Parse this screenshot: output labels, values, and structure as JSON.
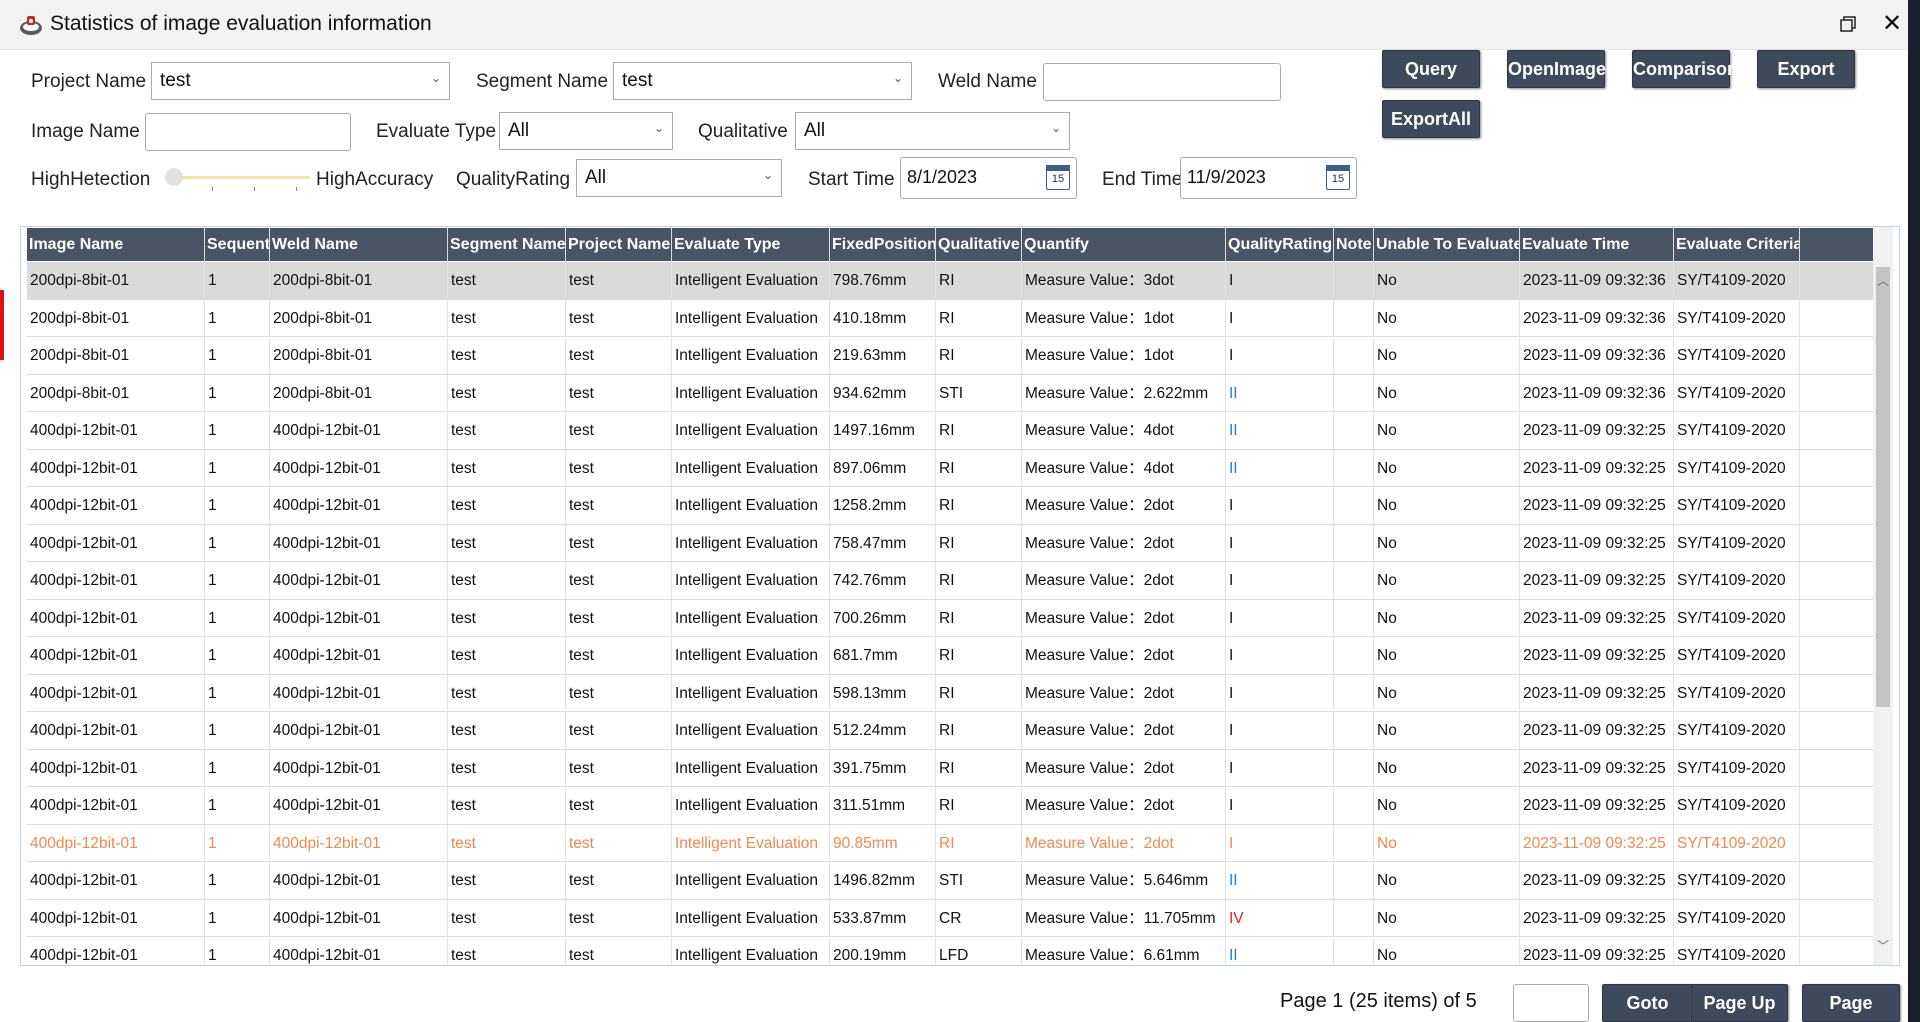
{
  "window": {
    "title": "Statistics of image evaluation information"
  },
  "filters": {
    "project_name_label": "Project Name",
    "project_name_value": "test",
    "segment_name_label": "Segment Name",
    "segment_name_value": "test",
    "weld_name_label": "Weld Name",
    "weld_name_value": "",
    "image_name_label": "Image Name",
    "image_name_value": "",
    "evaluate_type_label": "Evaluate Type",
    "evaluate_type_value": "All",
    "qualitative_label": "Qualitative",
    "qualitative_value": "All",
    "high_detection_label": "HighHetection",
    "high_accuracy_label": "HighAccuracy",
    "quality_rating_label": "QualityRating",
    "quality_rating_value": "All",
    "start_time_label": "Start Time",
    "start_time_value": "8/1/2023",
    "end_time_label": "End Time",
    "end_time_value": "11/9/2023",
    "calendar_day": "15"
  },
  "buttons": {
    "query": "Query",
    "open_image": "OpenImage",
    "comparison": "Comparison",
    "export": "Export",
    "export_all": "ExportAll"
  },
  "grid": {
    "columns": [
      "Image Name",
      "Sequent",
      "Weld Name",
      "Segment Name",
      "Project Name",
      "Evaluate Type",
      "FixedPosition",
      "Qualitative",
      "Quantify",
      "QualityRating",
      "Note",
      "Unable To Evaluate",
      "Evaluate Time",
      "Evaluate Criteria"
    ],
    "rows": [
      [
        "200dpi-8bit-01",
        "1",
        "200dpi-8bit-01",
        "test",
        "test",
        "Intelligent Evaluation",
        "798.76mm",
        "RI",
        "Measure Value：3dot",
        "I",
        "",
        "No",
        "2023-11-09 09:32:36",
        "SY/T4109-2020"
      ],
      [
        "200dpi-8bit-01",
        "1",
        "200dpi-8bit-01",
        "test",
        "test",
        "Intelligent Evaluation",
        "410.18mm",
        "RI",
        "Measure Value：1dot",
        "I",
        "",
        "No",
        "2023-11-09 09:32:36",
        "SY/T4109-2020"
      ],
      [
        "200dpi-8bit-01",
        "1",
        "200dpi-8bit-01",
        "test",
        "test",
        "Intelligent Evaluation",
        "219.63mm",
        "RI",
        "Measure Value：1dot",
        "I",
        "",
        "No",
        "2023-11-09 09:32:36",
        "SY/T4109-2020"
      ],
      [
        "200dpi-8bit-01",
        "1",
        "200dpi-8bit-01",
        "test",
        "test",
        "Intelligent Evaluation",
        "934.62mm",
        "STI",
        "Measure Value：2.622mm",
        "II",
        "",
        "No",
        "2023-11-09 09:32:36",
        "SY/T4109-2020"
      ],
      [
        "400dpi-12bit-01",
        "1",
        "400dpi-12bit-01",
        "test",
        "test",
        "Intelligent Evaluation",
        "1497.16mm",
        "RI",
        "Measure Value：4dot",
        "II",
        "",
        "No",
        "2023-11-09 09:32:25",
        "SY/T4109-2020"
      ],
      [
        "400dpi-12bit-01",
        "1",
        "400dpi-12bit-01",
        "test",
        "test",
        "Intelligent Evaluation",
        "897.06mm",
        "RI",
        "Measure Value：4dot",
        "II",
        "",
        "No",
        "2023-11-09 09:32:25",
        "SY/T4109-2020"
      ],
      [
        "400dpi-12bit-01",
        "1",
        "400dpi-12bit-01",
        "test",
        "test",
        "Intelligent Evaluation",
        "1258.2mm",
        "RI",
        "Measure Value：2dot",
        "I",
        "",
        "No",
        "2023-11-09 09:32:25",
        "SY/T4109-2020"
      ],
      [
        "400dpi-12bit-01",
        "1",
        "400dpi-12bit-01",
        "test",
        "test",
        "Intelligent Evaluation",
        "758.47mm",
        "RI",
        "Measure Value：2dot",
        "I",
        "",
        "No",
        "2023-11-09 09:32:25",
        "SY/T4109-2020"
      ],
      [
        "400dpi-12bit-01",
        "1",
        "400dpi-12bit-01",
        "test",
        "test",
        "Intelligent Evaluation",
        "742.76mm",
        "RI",
        "Measure Value：2dot",
        "I",
        "",
        "No",
        "2023-11-09 09:32:25",
        "SY/T4109-2020"
      ],
      [
        "400dpi-12bit-01",
        "1",
        "400dpi-12bit-01",
        "test",
        "test",
        "Intelligent Evaluation",
        "700.26mm",
        "RI",
        "Measure Value：2dot",
        "I",
        "",
        "No",
        "2023-11-09 09:32:25",
        "SY/T4109-2020"
      ],
      [
        "400dpi-12bit-01",
        "1",
        "400dpi-12bit-01",
        "test",
        "test",
        "Intelligent Evaluation",
        "681.7mm",
        "RI",
        "Measure Value：2dot",
        "I",
        "",
        "No",
        "2023-11-09 09:32:25",
        "SY/T4109-2020"
      ],
      [
        "400dpi-12bit-01",
        "1",
        "400dpi-12bit-01",
        "test",
        "test",
        "Intelligent Evaluation",
        "598.13mm",
        "RI",
        "Measure Value：2dot",
        "I",
        "",
        "No",
        "2023-11-09 09:32:25",
        "SY/T4109-2020"
      ],
      [
        "400dpi-12bit-01",
        "1",
        "400dpi-12bit-01",
        "test",
        "test",
        "Intelligent Evaluation",
        "512.24mm",
        "RI",
        "Measure Value：2dot",
        "I",
        "",
        "No",
        "2023-11-09 09:32:25",
        "SY/T4109-2020"
      ],
      [
        "400dpi-12bit-01",
        "1",
        "400dpi-12bit-01",
        "test",
        "test",
        "Intelligent Evaluation",
        "391.75mm",
        "RI",
        "Measure Value：2dot",
        "I",
        "",
        "No",
        "2023-11-09 09:32:25",
        "SY/T4109-2020"
      ],
      [
        "400dpi-12bit-01",
        "1",
        "400dpi-12bit-01",
        "test",
        "test",
        "Intelligent Evaluation",
        "311.51mm",
        "RI",
        "Measure Value：2dot",
        "I",
        "",
        "No",
        "2023-11-09 09:32:25",
        "SY/T4109-2020"
      ],
      [
        "400dpi-12bit-01",
        "1",
        "400dpi-12bit-01",
        "test",
        "test",
        "Intelligent Evaluation",
        "90.85mm",
        "RI",
        "Measure Value：2dot",
        "I",
        "",
        "No",
        "2023-11-09 09:32:25",
        "SY/T4109-2020"
      ],
      [
        "400dpi-12bit-01",
        "1",
        "400dpi-12bit-01",
        "test",
        "test",
        "Intelligent Evaluation",
        "1496.82mm",
        "STI",
        "Measure Value：5.646mm",
        "II",
        "",
        "No",
        "2023-11-09 09:32:25",
        "SY/T4109-2020"
      ],
      [
        "400dpi-12bit-01",
        "1",
        "400dpi-12bit-01",
        "test",
        "test",
        "Intelligent Evaluation",
        "533.87mm",
        "CR",
        "Measure Value：11.705mm",
        "IV",
        "",
        "No",
        "2023-11-09 09:32:25",
        "SY/T4109-2020"
      ],
      [
        "400dpi-12bit-01",
        "1",
        "400dpi-12bit-01",
        "test",
        "test",
        "Intelligent Evaluation",
        "200.19mm",
        "LFD",
        "Measure Value：6.61mm",
        "II",
        "",
        "No",
        "2023-11-09 09:32:25",
        "SY/T4109-2020"
      ]
    ],
    "selected_row": 0,
    "highlighted_row": 15,
    "rating_colors": {
      "II": "#1e7fd0",
      "IV": "#e02020"
    },
    "highlight_color": "#f08a4b"
  },
  "pager": {
    "text": "Page 1 (25 items) of 5",
    "goto": "Goto",
    "page_up": "Page Up",
    "page_down": "Page Down"
  }
}
